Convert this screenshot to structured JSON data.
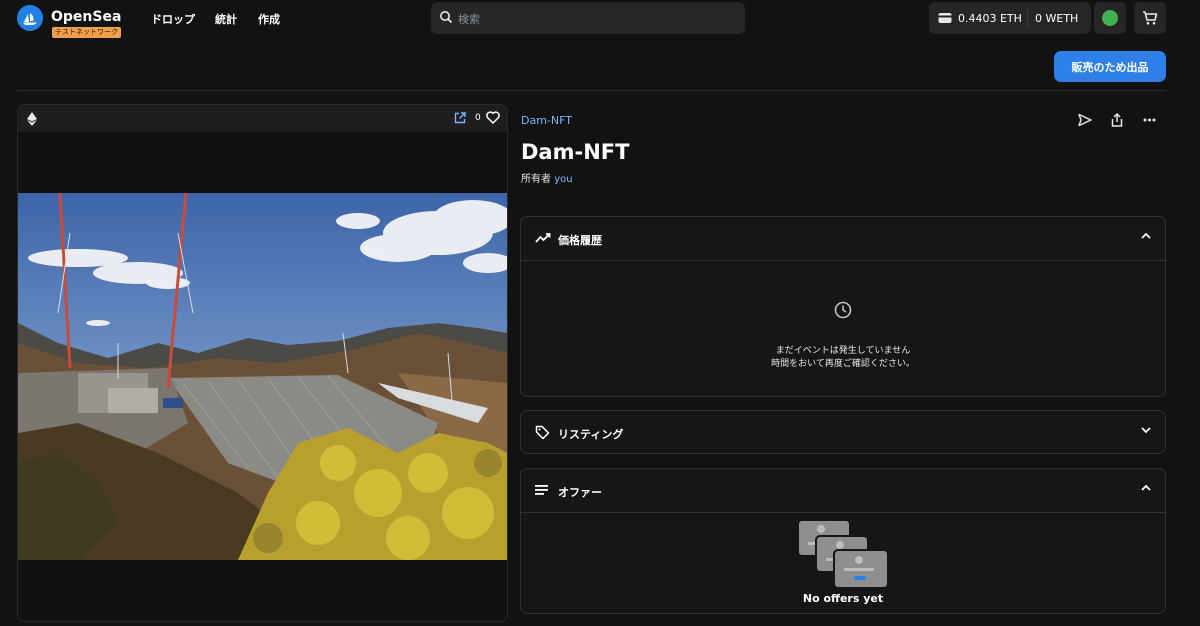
{
  "header": {
    "brand": "OpenSea",
    "testnet_badge": "テストネットワーク",
    "nav": [
      {
        "label": "ドロップ"
      },
      {
        "label": "統計"
      },
      {
        "label": "作成"
      }
    ],
    "search": {
      "placeholder": "検索"
    },
    "wallet": {
      "eth_balance": "0.4403 ETH",
      "weth_balance": "0 WETH"
    }
  },
  "toolbar": {
    "sell_label": "販売のため出品"
  },
  "media": {
    "favorite_count": "0"
  },
  "item": {
    "collection": "Dam-NFT",
    "title": "Dam-NFT",
    "owner_prefix": "所有者",
    "owner_name": "you"
  },
  "panels": {
    "price_history": {
      "title": "価格履歴",
      "empty_line1": "まだイベントは発生していません",
      "empty_line2": "時間をおいて再度ご確認ください。"
    },
    "listings": {
      "title": "リスティング"
    },
    "offers": {
      "title": "オファー",
      "empty": "No offers yet"
    }
  },
  "colors": {
    "accent": "#2e7fe8",
    "link": "#7fb3ff",
    "background": "#121212",
    "testnet_badge": "#f0a04b"
  },
  "icons": [
    "opensea-logo-icon",
    "search-icon",
    "wallet-icon",
    "avatar-icon",
    "cart-icon",
    "ethereum-icon",
    "external-link-icon",
    "heart-icon",
    "send-icon",
    "share-icon",
    "more-icon",
    "trend-icon",
    "clock-icon",
    "tag-icon",
    "list-icon",
    "chevron-up-icon",
    "chevron-down-icon",
    "offers-illustration"
  ]
}
